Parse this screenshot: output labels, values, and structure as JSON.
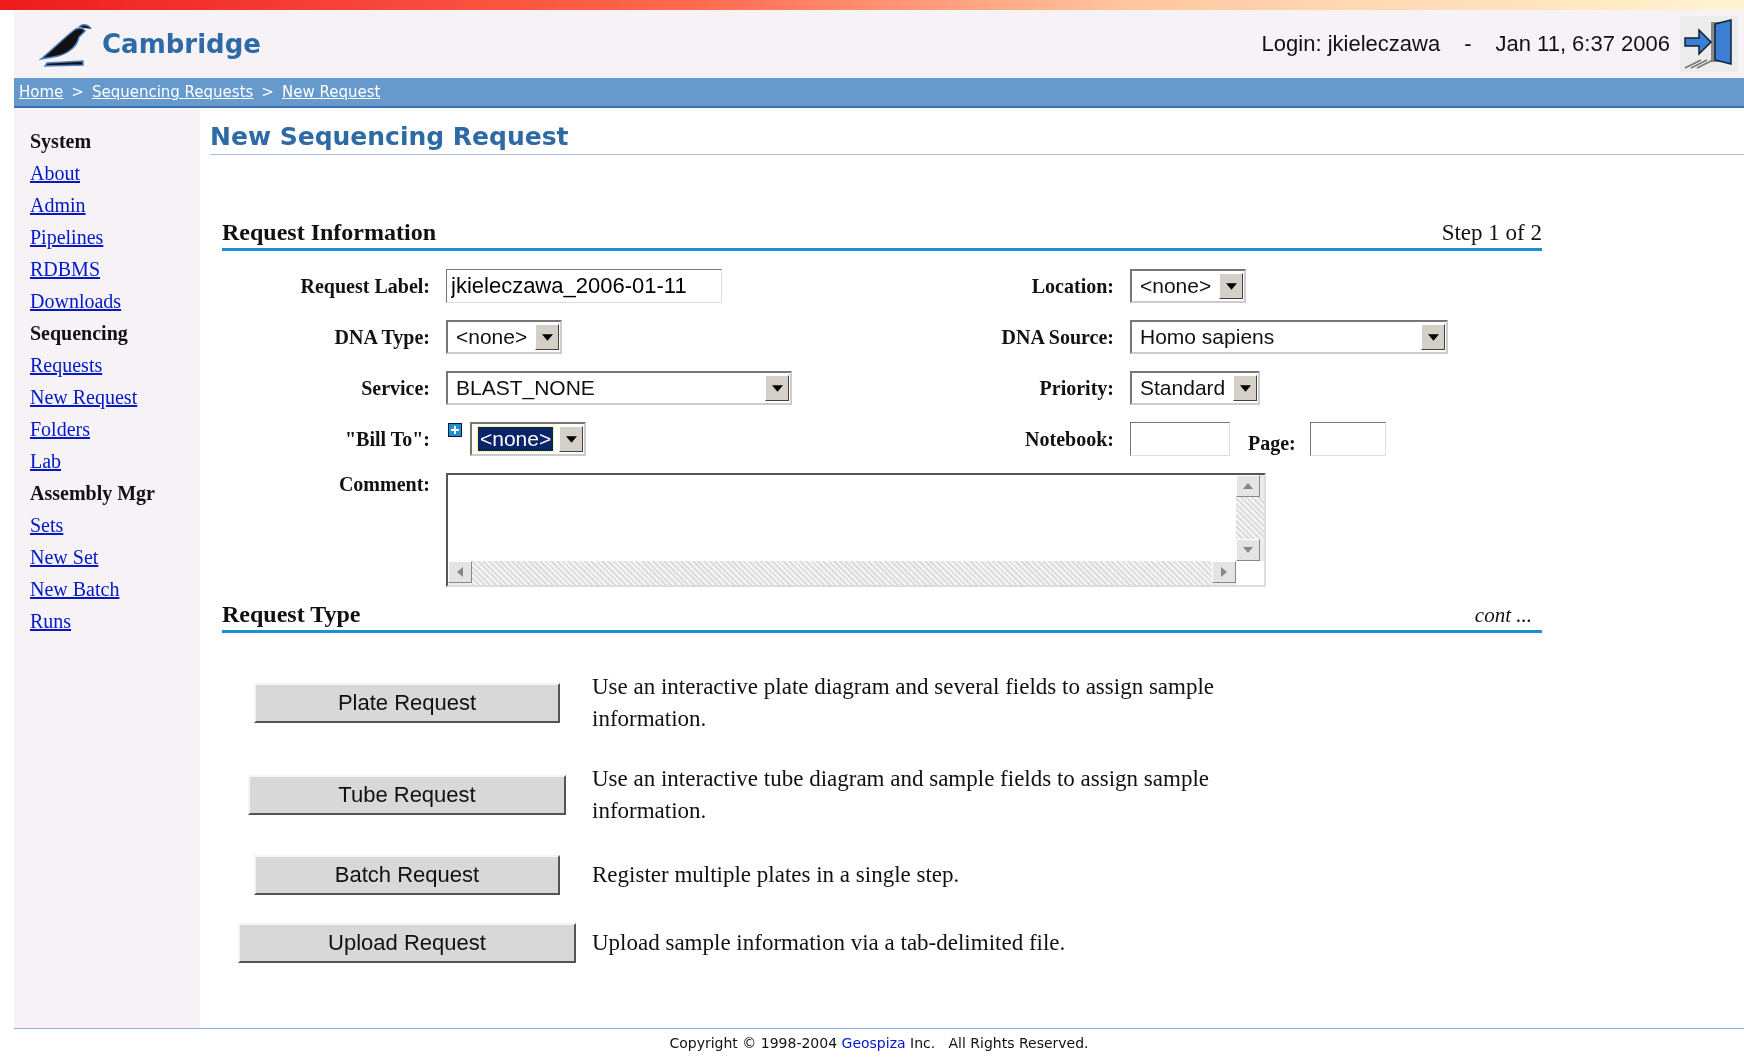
{
  "header": {
    "brand": "Cambridge",
    "login": "Login: jkieleczawa",
    "separator": "-",
    "datetime": "Jan 11, 6:37 2006"
  },
  "breadcrumb": {
    "items": [
      "Home",
      "Sequencing Requests",
      "New Request"
    ],
    "separator": ">"
  },
  "sidebar": {
    "items": [
      {
        "kind": "heading",
        "label": "System"
      },
      {
        "kind": "link",
        "label": "About"
      },
      {
        "kind": "link",
        "label": "Admin"
      },
      {
        "kind": "link",
        "label": "Pipelines"
      },
      {
        "kind": "link",
        "label": "RDBMS"
      },
      {
        "kind": "link",
        "label": "Downloads"
      },
      {
        "kind": "heading",
        "label": "Sequencing"
      },
      {
        "kind": "link",
        "label": "Requests"
      },
      {
        "kind": "link",
        "label": "New Request"
      },
      {
        "kind": "link",
        "label": "Folders"
      },
      {
        "kind": "link",
        "label": "Lab"
      },
      {
        "kind": "heading",
        "label": "Assembly Mgr"
      },
      {
        "kind": "link",
        "label": "Sets"
      },
      {
        "kind": "link",
        "label": "New Set"
      },
      {
        "kind": "link",
        "label": "New Batch"
      },
      {
        "kind": "link",
        "label": "Runs"
      }
    ]
  },
  "page_title": "New Sequencing Request",
  "request_information": {
    "title": "Request Information",
    "step": "Step 1 of 2",
    "rows": [
      {
        "left": [
          {
            "label": "Request Label:",
            "kind": "text",
            "value": "jkieleczawa_2006-01-11"
          }
        ],
        "right": [
          {
            "label": "Location:",
            "kind": "select",
            "value": "<none>",
            "focused": false
          }
        ]
      },
      {
        "left": [
          {
            "label": "DNA Type:",
            "kind": "select",
            "value": "<none>",
            "focused": false
          }
        ],
        "right": [
          {
            "label": "DNA Source:",
            "kind": "select",
            "value": "Homo sapiens",
            "focused": false
          }
        ]
      },
      {
        "left": [
          {
            "label": "Service:",
            "kind": "select",
            "value": "BLAST_NONE",
            "focused": false
          }
        ],
        "right": [
          {
            "label": "Priority:",
            "kind": "select",
            "value": "Standard",
            "focused": false
          }
        ]
      },
      {
        "left": [
          {
            "label": "\"Bill To\":",
            "kind": "select",
            "value": "<none>",
            "focused": true,
            "add_button": true
          }
        ],
        "right": [
          {
            "label": "Notebook:",
            "kind": "text"
          },
          {
            "label": "Page:",
            "kind": "text"
          }
        ]
      }
    ],
    "comment": {
      "label": "Comment:"
    }
  },
  "request_type": {
    "title": "Request Type",
    "more": "cont ...",
    "options": [
      {
        "button": "Plate Request",
        "description": "Use an interactive plate diagram and several fields to assign sample information."
      },
      {
        "button": "Tube Request",
        "description": "Use an interactive tube diagram and sample fields to assign sample information."
      },
      {
        "button": "Batch Request",
        "description": "Register multiple plates in a single step."
      },
      {
        "button": "Upload Request",
        "description": "Upload sample information via a tab-delimited file."
      }
    ]
  },
  "footer": {
    "before": "Copyright © 1998-2004",
    "link": "Geospiza",
    "after": "Inc.   All Rights Reserved."
  }
}
